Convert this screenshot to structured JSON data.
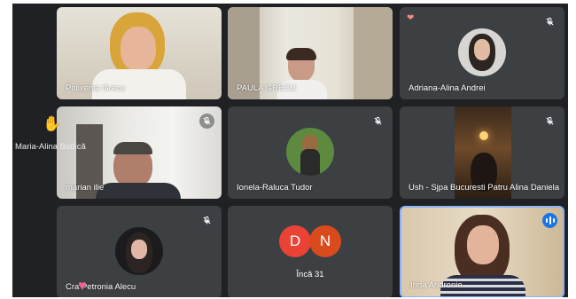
{
  "participants": [
    {
      "name": "Polixenia Grecu"
    },
    {
      "name": "PAULA GRECU"
    },
    {
      "name": "Adriana-Alina Andrei"
    },
    {
      "name": "marian ilie"
    },
    {
      "name": "Ionela-Raluca Tudor"
    },
    {
      "name": "Ush - Sjpa Bucuresti Patru Alina Daniela"
    },
    {
      "name": "Cra  Petronia Alecu"
    },
    {
      "name": "Irina Andronie"
    }
  ],
  "more_tile": {
    "avatars": [
      "D",
      "N"
    ],
    "label": "Încă 31"
  },
  "floating_participant": "Maria-Alina Bodică",
  "colors": {
    "background": "#202124",
    "tile": "#3c4043",
    "avatar_d": "#ea4335",
    "avatar_n": "#d94b1c",
    "active_speaker_border": "#8ab4f8",
    "speaking_badge": "#1a73e8"
  }
}
